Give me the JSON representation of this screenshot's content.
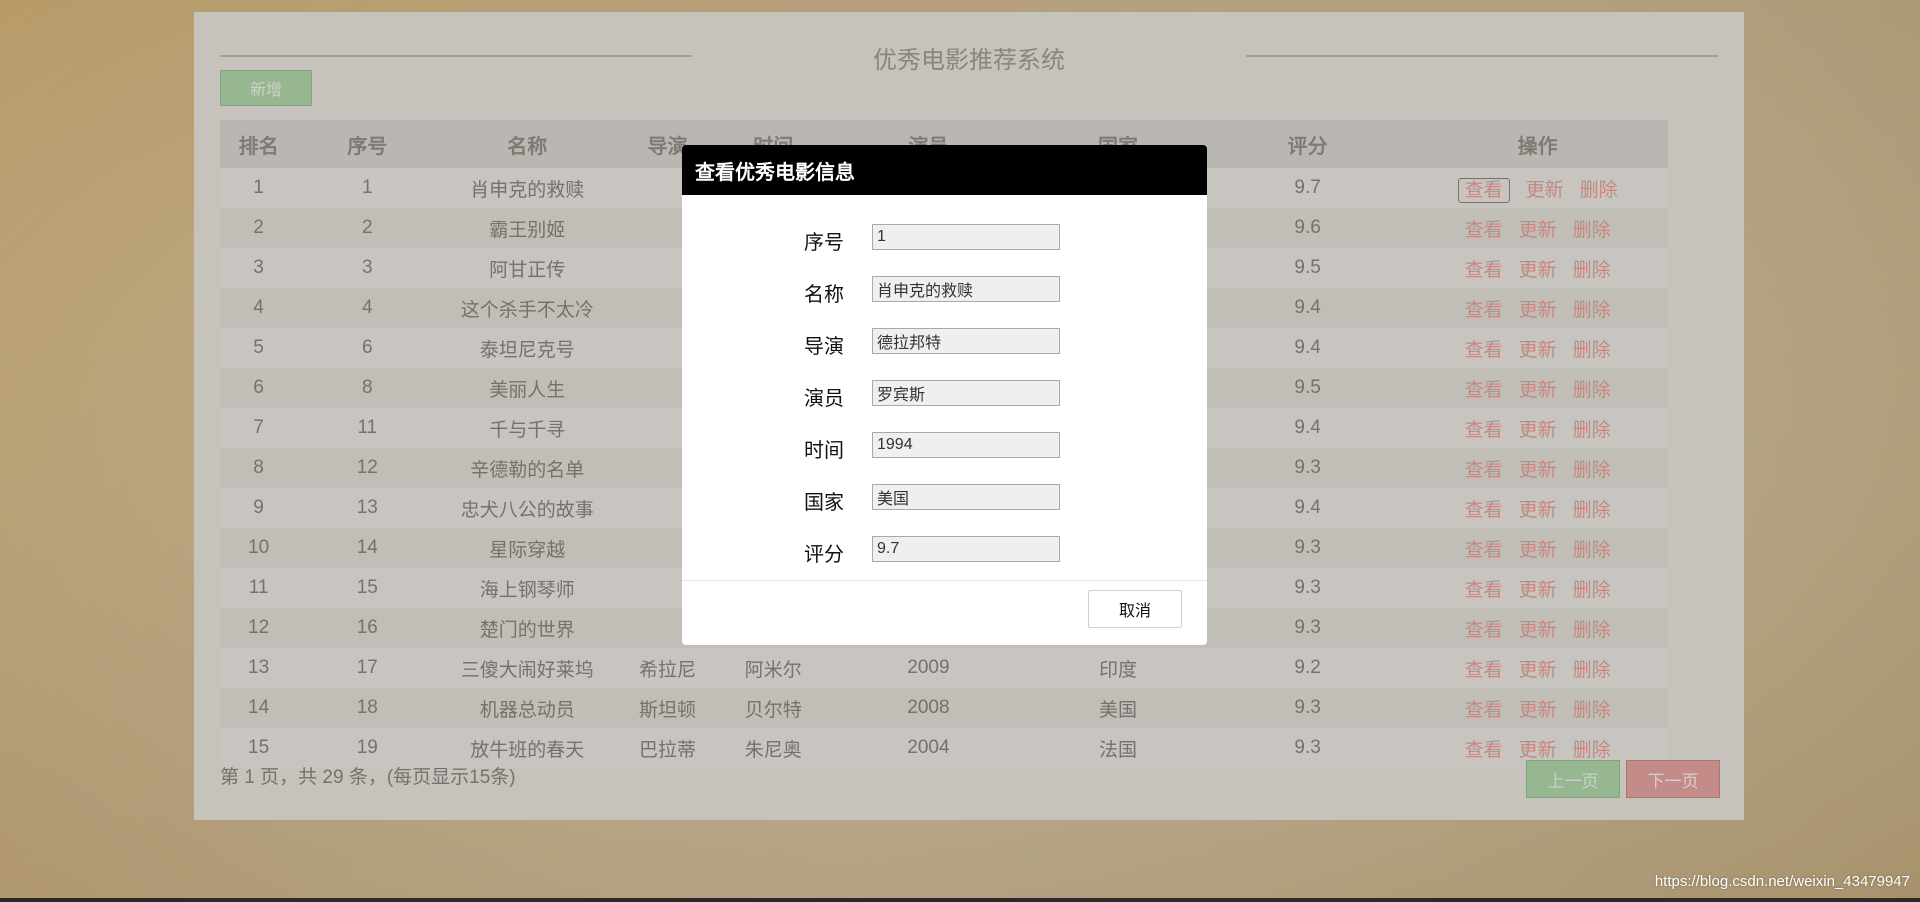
{
  "page": {
    "title": "优秀电影推荐系统",
    "add_button": "新增"
  },
  "table": {
    "headers": [
      "排名",
      "序号",
      "名称",
      "导演",
      "时间",
      "演员",
      "国家",
      "评分",
      "操作"
    ],
    "rows": [
      {
        "rank": "1",
        "id": "1",
        "name": "肖申克的救赎",
        "director": "",
        "time": "",
        "actor": "",
        "country": "",
        "score": "9.7"
      },
      {
        "rank": "2",
        "id": "2",
        "name": "霸王别姬",
        "director": "",
        "time": "",
        "actor": "",
        "country": "",
        "score": "9.6"
      },
      {
        "rank": "3",
        "id": "3",
        "name": "阿甘正传",
        "director": "",
        "time": "",
        "actor": "",
        "country": "",
        "score": "9.5"
      },
      {
        "rank": "4",
        "id": "4",
        "name": "这个杀手不太冷",
        "director": "",
        "time": "",
        "actor": "",
        "country": "",
        "score": "9.4"
      },
      {
        "rank": "5",
        "id": "6",
        "name": "泰坦尼克号",
        "director": "",
        "time": "",
        "actor": "",
        "country": "",
        "score": "9.4"
      },
      {
        "rank": "6",
        "id": "8",
        "name": "美丽人生",
        "director": "",
        "time": "",
        "actor": "",
        "country": "",
        "score": "9.5"
      },
      {
        "rank": "7",
        "id": "11",
        "name": "千与千寻",
        "director": "",
        "time": "",
        "actor": "",
        "country": "",
        "score": "9.4"
      },
      {
        "rank": "8",
        "id": "12",
        "name": "辛德勒的名单",
        "director": "",
        "time": "",
        "actor": "",
        "country": "",
        "score": "9.3"
      },
      {
        "rank": "9",
        "id": "13",
        "name": "忠犬八公的故事",
        "director": "",
        "time": "",
        "actor": "",
        "country": "",
        "score": "9.4"
      },
      {
        "rank": "10",
        "id": "14",
        "name": "星际穿越",
        "director": "",
        "time": "",
        "actor": "",
        "country": "",
        "score": "9.3"
      },
      {
        "rank": "11",
        "id": "15",
        "name": "海上钢琴师",
        "director": "",
        "time": "",
        "actor": "",
        "country": "",
        "score": "9.3"
      },
      {
        "rank": "12",
        "id": "16",
        "name": "楚门的世界",
        "director": "",
        "time": "",
        "actor": "",
        "country": "",
        "score": "9.3"
      },
      {
        "rank": "13",
        "id": "17",
        "name": "三傻大闹好莱坞",
        "director": "希拉尼",
        "time": "阿米尔",
        "actor": "2009",
        "country": "印度",
        "score": "9.2"
      },
      {
        "rank": "14",
        "id": "18",
        "name": "机器总动员",
        "director": "斯坦顿",
        "time": "贝尔特",
        "actor": "2008",
        "country": "美国",
        "score": "9.3"
      },
      {
        "rank": "15",
        "id": "19",
        "name": "放牛班的春天",
        "director": "巴拉蒂",
        "time": "朱尼奥",
        "actor": "2004",
        "country": "法国",
        "score": "9.3"
      }
    ],
    "actions": {
      "view": "查看",
      "update": "更新",
      "delete": "删除"
    }
  },
  "pagination": {
    "summary": "第 1 页，共 29 条，(每页显示15条)",
    "prev": "上一页",
    "next": "下一页"
  },
  "modal": {
    "title": "查看优秀电影信息",
    "fields": [
      {
        "label": "序号",
        "value": "1"
      },
      {
        "label": "名称",
        "value": "肖申克的救赎"
      },
      {
        "label": "导演",
        "value": "德拉邦特"
      },
      {
        "label": "演员",
        "value": "罗宾斯"
      },
      {
        "label": "时间",
        "value": "1994"
      },
      {
        "label": "国家",
        "value": "美国"
      },
      {
        "label": "评分",
        "value": "9.7"
      }
    ],
    "cancel": "取消"
  },
  "watermark": "https://blog.csdn.net/weixin_43479947"
}
